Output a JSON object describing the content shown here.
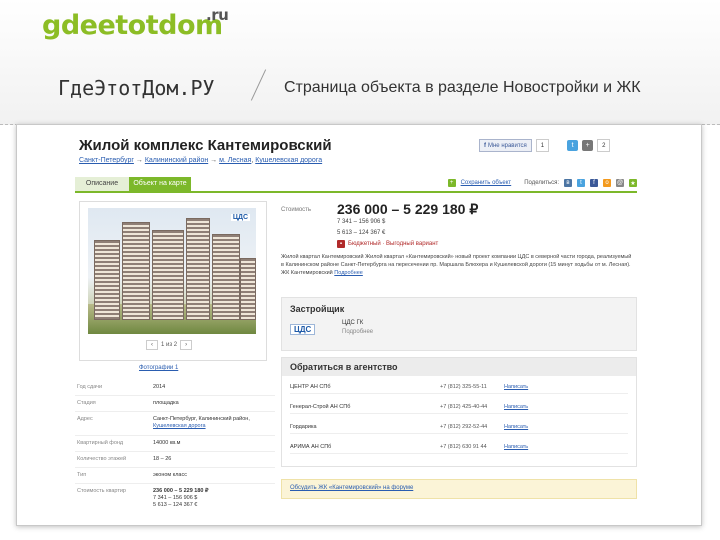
{
  "slide": {
    "logo_main": "gdeetotdom",
    "logo_ru": ".ru",
    "site_name": "ГдеЭтотДом.РУ",
    "title": "Страница объекта в разделе Новостройки и ЖК"
  },
  "page": {
    "heading": "Жилой комплекс Кантемировский",
    "breadcrumbs": [
      "Санкт-Петербург",
      "Калининский район",
      "м. Лесная",
      "Кушелевская дорога"
    ],
    "crumb_sep": "→",
    "like_label": "Мне нравится",
    "like_count": "1",
    "plusone_count": "2",
    "tabs": [
      "Описание",
      "Объект на карте"
    ],
    "save_label": "Сохранить объект",
    "share_label": "Поделиться:",
    "price_label": "Стоимость",
    "price": "236 000 – 5 229 180 ₽",
    "price_line2": "7 341 – 156 906 $",
    "price_line3": "5 613 – 124 367 €",
    "price_feed": "Бюджетный · Выгодный вариант",
    "description": "Жилой квартал Кантемировский Жилой квартал «Кантемировский» новый проект компании ЦДС в северной части города, реализуемый в Калининском районе Санкт-Петербурга на пересечении пр. Маршала Блюхера и Кушелевской дороги (15 минут ходьбы от м. Лесная). ЖК Кантемировский",
    "description_more": "Подробнее",
    "photo_brand": "ЦДС",
    "pager_text": "1 из 2",
    "photo_link": "Фотографии 1",
    "developer": {
      "heading": "Застройщик",
      "logo": "ЦДС",
      "name": "ЦДС ГК",
      "sub": "Подробнее"
    },
    "agencies": {
      "heading": "Обратиться в агентство",
      "write": "Написать",
      "rows": [
        {
          "name": "ЦЕНТР АН СПб",
          "phone": "+7 (812) 325-55-11"
        },
        {
          "name": "Генерал-Строй АН СПб",
          "phone": "+7 (812) 425-40-44"
        },
        {
          "name": "Гордарика",
          "phone": "+7 (812) 292-52-44"
        },
        {
          "name": "АРИМА АН СПб",
          "phone": "+7 (812) 630 91 44"
        }
      ]
    },
    "discuss": "Обсудить ЖК «Кантемировский» на форуме",
    "params": [
      {
        "k": "Год сдачи",
        "v": "2014"
      },
      {
        "k": "Стадия",
        "v": "площадка"
      },
      {
        "k": "Адрес",
        "v": "Санкт-Петербург, Калининский район,",
        "link": "Кушелевская дорога"
      },
      {
        "k": "Квартирный фонд",
        "v": "14000 кв.м"
      },
      {
        "k": "Количество этажей",
        "v": "18 – 26"
      },
      {
        "k": "Тип",
        "v": "эконом класс"
      },
      {
        "k": "Стоимость квартир",
        "v": "236 000 – 5 229 180 ₽",
        "v2": "7 341 – 156 906 $",
        "v3": "5 613 – 124 367 €"
      }
    ]
  },
  "colors": {
    "accent_green": "#7cb82a",
    "link_blue": "#2a5db0"
  }
}
